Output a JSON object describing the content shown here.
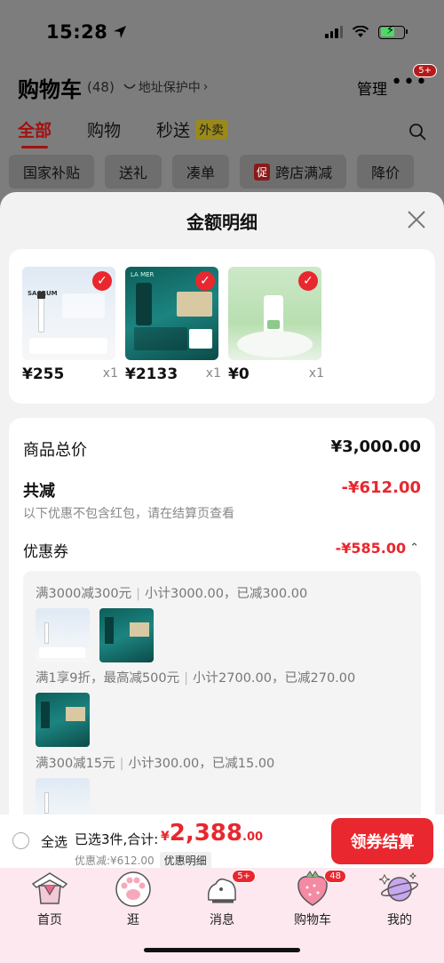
{
  "status_bar": {
    "time": "15:28"
  },
  "header": {
    "title": "购物车",
    "count": "(48)",
    "address_protect": "地址保护中",
    "manage": "管理",
    "more_badge": "5+"
  },
  "tabs": [
    {
      "label": "全部"
    },
    {
      "label": "购物"
    },
    {
      "label": "秒送"
    }
  ],
  "takeout_badge": "外卖",
  "chips": [
    {
      "label": "国家补贴"
    },
    {
      "label": "送礼"
    },
    {
      "label": "凑单"
    },
    {
      "label": "跨店满减",
      "badge": "促"
    },
    {
      "label": "降价"
    }
  ],
  "sheet": {
    "title": "金额明细",
    "products": [
      {
        "price": "¥255",
        "qty": "x1",
        "brand": "SACRUM"
      },
      {
        "price": "¥2133",
        "qty": "x1",
        "brand": "LA MER"
      },
      {
        "price": "¥0",
        "qty": "x1",
        "brand": ""
      }
    ],
    "product_total_label": "商品总价",
    "product_total_value": "¥3,000.00",
    "reduced_label": "共减",
    "reduced_value": "-¥612.00",
    "reduced_note": "以下优惠不包含红包，请在结算页查看",
    "coupon_label": "优惠券",
    "coupon_value": "-¥585.00",
    "rules": [
      {
        "condition": "满3000减300元",
        "detail": "小计3000.00，已减300.00"
      },
      {
        "condition": "满1享9折，最高减500元",
        "detail": "小计2700.00，已减270.00"
      },
      {
        "condition": "满300减15元",
        "detail": "小计300.00，已减15.00"
      }
    ]
  },
  "action_bar": {
    "select_all": "全选",
    "selected_summary": "已选3件,合计:",
    "currency": "¥",
    "total_int": "2,388",
    "total_dec": ".00",
    "discount_text": "优惠减:¥612.00",
    "detail_chip": "优惠明细",
    "checkout": "领券结算"
  },
  "nav": [
    {
      "label": "首页",
      "icon": "home-icon"
    },
    {
      "label": "逛",
      "icon": "paw-icon"
    },
    {
      "label": "消息",
      "icon": "message-icon",
      "badge": "5+"
    },
    {
      "label": "购物车",
      "icon": "cart-icon",
      "badge": "48"
    },
    {
      "label": "我的",
      "icon": "profile-icon"
    }
  ],
  "colors": {
    "accent": "#e8272f",
    "sheet_bg": "#f2f2f2",
    "tab_bar_bg": "#fde8ef"
  }
}
